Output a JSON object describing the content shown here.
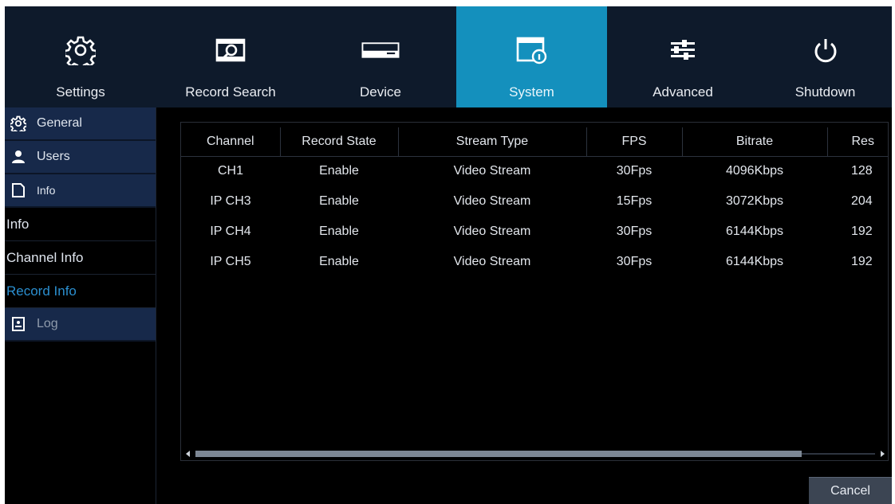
{
  "nav": {
    "items": [
      {
        "label": "Settings",
        "icon": "gear-icon"
      },
      {
        "label": "Record Search",
        "icon": "record-search-icon"
      },
      {
        "label": "Device",
        "icon": "hard-drive-icon"
      },
      {
        "label": "System",
        "icon": "system-info-icon",
        "active": true
      },
      {
        "label": "Advanced",
        "icon": "sliders-icon"
      },
      {
        "label": "Shutdown",
        "icon": "power-icon"
      }
    ]
  },
  "sidebar": {
    "general": "General",
    "users": "Users",
    "info": "Info",
    "sub_items": [
      "Info",
      "Channel Info",
      "Record Info"
    ],
    "active_sub": "Record Info",
    "log": "Log"
  },
  "table": {
    "headers": [
      "Channel",
      "Record State",
      "Stream Type",
      "FPS",
      "Bitrate",
      "Res"
    ],
    "rows": [
      [
        "CH1",
        "Enable",
        "Video Stream",
        "30Fps",
        "4096Kbps",
        "128"
      ],
      [
        "IP CH3",
        "Enable",
        "Video Stream",
        "15Fps",
        "3072Kbps",
        "204"
      ],
      [
        "IP CH4",
        "Enable",
        "Video Stream",
        "30Fps",
        "6144Kbps",
        "192"
      ],
      [
        "IP CH5",
        "Enable",
        "Video Stream",
        "30Fps",
        "6144Kbps",
        "192"
      ]
    ]
  },
  "cancel_label": "Cancel",
  "colors": {
    "nav_bg": "#0e1a2b",
    "active_tab": "#1490bd",
    "sidebar_head": "#17294a",
    "active_sub_text": "#2b8fd0"
  }
}
